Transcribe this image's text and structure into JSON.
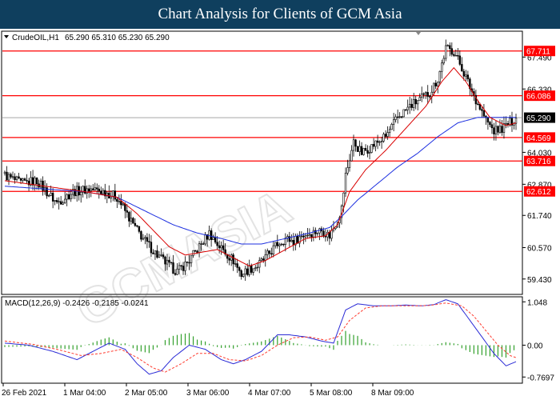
{
  "header": {
    "title": "Chart Analysis for Clients of GCM Asia"
  },
  "colors": {
    "header_bg": "#0f3f5e",
    "bull_candle": "#00a000",
    "bear_candle": "#000000",
    "ma_fast": "#d90000",
    "ma_slow": "#1c2fe0",
    "level_line": "#ff0000",
    "level_label_bg": "#ff0000",
    "price_label_bg": "#000000",
    "macd_hist": "#33a02c",
    "macd_line": "#2b2bd6",
    "signal_line": "#ff3b2f"
  },
  "chart_data": [
    {
      "type": "candlestick",
      "symbol_label": "CrudeOIL,H1",
      "ohlc_label": "65.290 65.310 65.230 65.290",
      "ylim": [
        58.9,
        68.4
      ],
      "y_ticks": [
        "67.490",
        "66.330",
        "64.030",
        "62.870",
        "61.740",
        "60.570",
        "59.430"
      ],
      "x_ticks": [
        "26 Feb 2021",
        "1 Mar 04:00",
        "2 Mar 05:00",
        "3 Mar 06:00",
        "4 Mar 07:00",
        "5 Mar 08:00",
        "8 Mar 09:00"
      ],
      "current_price": 65.29,
      "current_price_label": "65.290",
      "levels": [
        {
          "value": 67.711,
          "label": "67.711"
        },
        {
          "value": 66.086,
          "label": "66.086"
        },
        {
          "value": 64.569,
          "label": "64.569"
        },
        {
          "value": 63.716,
          "label": "63.716"
        },
        {
          "value": 62.612,
          "label": "62.612"
        }
      ],
      "close_path": [
        [
          0,
          63.2
        ],
        [
          8,
          62.9
        ],
        [
          16,
          63.0
        ],
        [
          22,
          62.5
        ],
        [
          26,
          62.2
        ],
        [
          34,
          62.6
        ],
        [
          42,
          62.7
        ],
        [
          50,
          62.6
        ],
        [
          56,
          62.4
        ],
        [
          60,
          61.9
        ],
        [
          64,
          61.4
        ],
        [
          70,
          60.8
        ],
        [
          76,
          60.3
        ],
        [
          82,
          59.9
        ],
        [
          86,
          59.7
        ],
        [
          92,
          60.1
        ],
        [
          98,
          60.7
        ],
        [
          102,
          61.1
        ],
        [
          106,
          60.7
        ],
        [
          110,
          60.4
        ],
        [
          114,
          60.1
        ],
        [
          118,
          59.6
        ],
        [
          122,
          59.8
        ],
        [
          126,
          59.9
        ],
        [
          130,
          60.2
        ],
        [
          136,
          60.7
        ],
        [
          140,
          60.9
        ],
        [
          144,
          60.8
        ],
        [
          148,
          61.0
        ],
        [
          152,
          61.1
        ],
        [
          158,
          61.2
        ],
        [
          162,
          61.0
        ],
        [
          166,
          61.6
        ],
        [
          168,
          62.0
        ],
        [
          170,
          63.2
        ],
        [
          174,
          64.4
        ],
        [
          178,
          64.0
        ],
        [
          184,
          64.3
        ],
        [
          190,
          64.6
        ],
        [
          196,
          65.3
        ],
        [
          202,
          65.7
        ],
        [
          208,
          66.0
        ],
        [
          212,
          66.2
        ],
        [
          216,
          66.7
        ],
        [
          220,
          67.8
        ],
        [
          224,
          67.7
        ],
        [
          228,
          67.1
        ],
        [
          232,
          66.4
        ],
        [
          236,
          65.8
        ],
        [
          240,
          65.2
        ],
        [
          244,
          64.8
        ],
        [
          248,
          64.9
        ],
        [
          252,
          65.1
        ],
        [
          255,
          65.3
        ]
      ],
      "ma_fast": [
        [
          0,
          63.0
        ],
        [
          20,
          62.8
        ],
        [
          40,
          62.6
        ],
        [
          56,
          62.4
        ],
        [
          66,
          61.8
        ],
        [
          74,
          61.2
        ],
        [
          82,
          60.6
        ],
        [
          90,
          60.3
        ],
        [
          98,
          60.4
        ],
        [
          106,
          60.5
        ],
        [
          114,
          60.2
        ],
        [
          122,
          59.9
        ],
        [
          130,
          60.1
        ],
        [
          140,
          60.5
        ],
        [
          150,
          60.9
        ],
        [
          160,
          61.0
        ],
        [
          166,
          61.4
        ],
        [
          172,
          62.6
        ],
        [
          180,
          63.4
        ],
        [
          190,
          64.1
        ],
        [
          200,
          64.9
        ],
        [
          210,
          65.7
        ],
        [
          218,
          66.6
        ],
        [
          224,
          67.1
        ],
        [
          230,
          66.6
        ],
        [
          236,
          65.9
        ],
        [
          242,
          65.3
        ],
        [
          250,
          65.0
        ],
        [
          255,
          65.1
        ]
      ],
      "ma_slow": [
        [
          0,
          62.8
        ],
        [
          20,
          62.7
        ],
        [
          40,
          62.6
        ],
        [
          56,
          62.4
        ],
        [
          70,
          61.9
        ],
        [
          84,
          61.4
        ],
        [
          96,
          61.1
        ],
        [
          108,
          60.9
        ],
        [
          118,
          60.7
        ],
        [
          128,
          60.7
        ],
        [
          140,
          60.9
        ],
        [
          152,
          61.1
        ],
        [
          162,
          61.3
        ],
        [
          168,
          61.7
        ],
        [
          176,
          62.3
        ],
        [
          186,
          62.9
        ],
        [
          196,
          63.5
        ],
        [
          206,
          64.0
        ],
        [
          216,
          64.6
        ],
        [
          226,
          65.1
        ],
        [
          236,
          65.3
        ],
        [
          246,
          65.3
        ],
        [
          255,
          65.3
        ]
      ]
    },
    {
      "type": "macd",
      "label": "MACD(12,26,9) -0.2426 -0.2185 -0.0241",
      "ylim": [
        -0.9,
        1.15
      ],
      "y_ticks": [
        "1.048",
        "0.00",
        "-0.7697"
      ],
      "macd_line": [
        [
          0,
          0.05
        ],
        [
          12,
          0.0
        ],
        [
          24,
          -0.15
        ],
        [
          36,
          -0.35
        ],
        [
          44,
          -0.15
        ],
        [
          52,
          0.05
        ],
        [
          60,
          -0.1
        ],
        [
          66,
          -0.45
        ],
        [
          72,
          -0.7
        ],
        [
          78,
          -0.62
        ],
        [
          84,
          -0.3
        ],
        [
          92,
          0.0
        ],
        [
          100,
          -0.1
        ],
        [
          108,
          -0.35
        ],
        [
          114,
          -0.45
        ],
        [
          120,
          -0.35
        ],
        [
          128,
          -0.15
        ],
        [
          136,
          0.25
        ],
        [
          142,
          0.25
        ],
        [
          150,
          0.2
        ],
        [
          158,
          0.1
        ],
        [
          164,
          0.05
        ],
        [
          170,
          0.85
        ],
        [
          176,
          1.0
        ],
        [
          184,
          0.95
        ],
        [
          192,
          0.95
        ],
        [
          200,
          0.97
        ],
        [
          208,
          0.95
        ],
        [
          214,
          0.98
        ],
        [
          220,
          1.1
        ],
        [
          226,
          1.0
        ],
        [
          232,
          0.6
        ],
        [
          238,
          0.2
        ],
        [
          244,
          -0.2
        ],
        [
          250,
          -0.5
        ],
        [
          255,
          -0.4
        ]
      ],
      "signal_line": [
        [
          0,
          0.1
        ],
        [
          14,
          0.02
        ],
        [
          26,
          -0.1
        ],
        [
          38,
          -0.25
        ],
        [
          48,
          -0.2
        ],
        [
          58,
          -0.1
        ],
        [
          66,
          -0.3
        ],
        [
          74,
          -0.55
        ],
        [
          80,
          -0.65
        ],
        [
          88,
          -0.45
        ],
        [
          96,
          -0.2
        ],
        [
          104,
          -0.2
        ],
        [
          112,
          -0.35
        ],
        [
          120,
          -0.38
        ],
        [
          128,
          -0.25
        ],
        [
          136,
          0.0
        ],
        [
          144,
          0.18
        ],
        [
          152,
          0.2
        ],
        [
          160,
          0.12
        ],
        [
          166,
          0.2
        ],
        [
          172,
          0.6
        ],
        [
          180,
          0.9
        ],
        [
          188,
          0.95
        ],
        [
          196,
          0.95
        ],
        [
          204,
          0.95
        ],
        [
          212,
          0.96
        ],
        [
          220,
          1.02
        ],
        [
          228,
          0.95
        ],
        [
          234,
          0.7
        ],
        [
          240,
          0.35
        ],
        [
          246,
          0.0
        ],
        [
          252,
          -0.25
        ],
        [
          255,
          -0.3
        ]
      ]
    }
  ]
}
